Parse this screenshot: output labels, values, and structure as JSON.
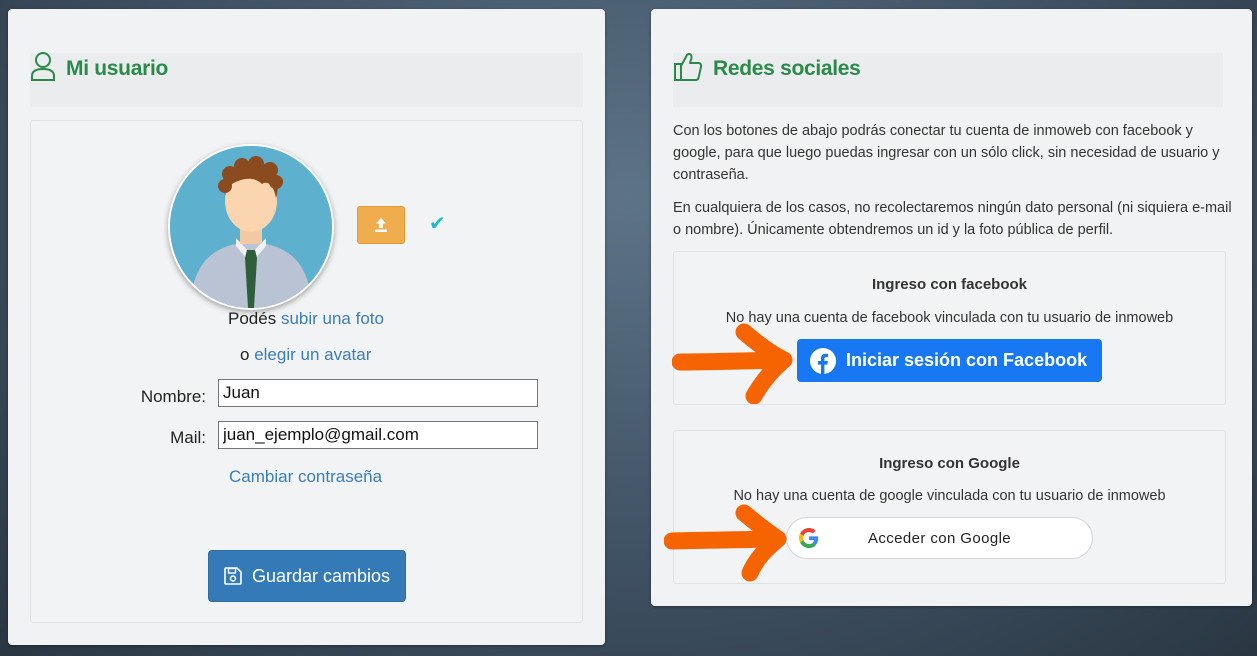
{
  "profile": {
    "title": "Mi usuario",
    "photo_prefix": "Podés",
    "upload_link": "subir una foto",
    "avatar_prefix": "o",
    "avatar_link": "elegir un avatar",
    "name_label": "Nombre:",
    "name_value": "Juan",
    "mail_label": "Mail:",
    "mail_value": "juan_ejemplo@gmail.com",
    "change_password": "Cambiar contraseña",
    "save_label": "Guardar cambios"
  },
  "social": {
    "title": "Redes sociales",
    "description_1": "Con los botones de abajo podrás conectar tu cuenta de inmoweb con facebook y google, para que luego puedas ingresar con un sólo click, sin necesidad de usuario y contraseña.",
    "description_2": "En cualquiera de los casos, no recolectaremos ningún dato personal (ni siquiera e-mail o nombre). Únicamente obtendremos un id y la foto pública de perfil.",
    "facebook": {
      "title": "Ingreso con facebook",
      "status": "No hay una cuenta de facebook vinculada con tu usuario de inmoweb",
      "button": "Iniciar sesión con Facebook"
    },
    "google": {
      "title": "Ingreso con Google",
      "status": "No hay una cuenta de google vinculada con tu usuario de inmoweb",
      "button": "Acceder con Google"
    }
  },
  "colors": {
    "accent_green": "#2b8a4a",
    "link_blue": "#3b7db8",
    "primary_blue": "#337ab7",
    "facebook_blue": "#1877f2",
    "upload_orange": "#f0ad4e",
    "annotation_orange": "#f56400"
  },
  "icons": [
    "user-icon",
    "upload-icon",
    "check-icon",
    "floppy-icon",
    "thumbs-up-icon",
    "facebook-icon",
    "google-icon"
  ]
}
